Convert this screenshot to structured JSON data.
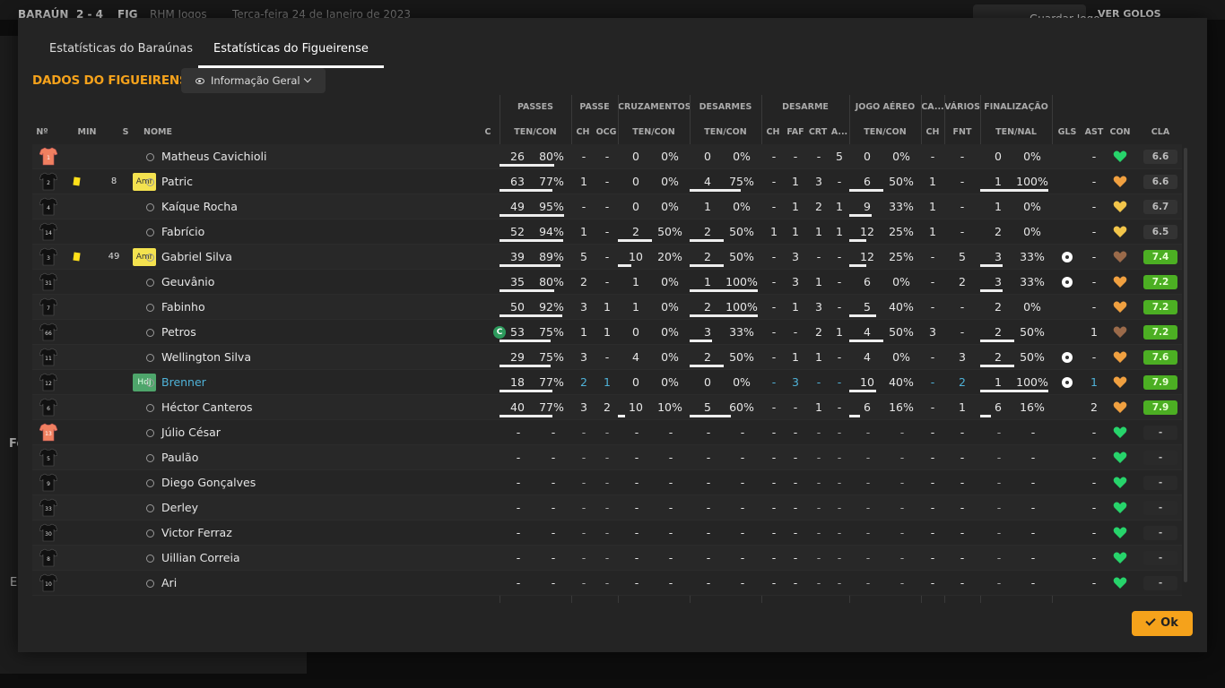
{
  "topbar": {
    "score_home": "BARAÚN",
    "score": "2 - 4",
    "score_away": "FIG",
    "venue": "RHM Jogos",
    "date": "Terça-feira 24 de Janeiro de 2023",
    "save_label": "Guardar Jogo",
    "ver_label": "VER GOLOS"
  },
  "background": {
    "text1": "Fo",
    "text2": "E"
  },
  "tabs": [
    {
      "label": "Estatísticas do Baraúnas",
      "active": false
    },
    {
      "label": "Estatísticas do Figueirense",
      "active": true
    }
  ],
  "section_title": "DADOS DO FIGUEIRENSE",
  "view_dropdown": {
    "selected": "Informação Geral"
  },
  "group_headers": [
    "PASSES",
    "PASSE",
    "CRUZAMENTOS",
    "DESARMES",
    "DESARME",
    "JOGO AÉREO",
    "CA...",
    "VÁRIOS",
    "FINALIZAÇÃO"
  ],
  "column_headers": {
    "num": "Nº",
    "min": "MIN",
    "s": "S",
    "name": "NOME",
    "c": "C",
    "passes": "TEN/CON",
    "passe_ch": "CH",
    "passe_ocg": "OCG",
    "cruz": "TEN/CON",
    "desarmes": "TEN/CON",
    "des_ch": "CH",
    "des_faf": "FAF",
    "des_crt": "CRT",
    "des_a": "A...",
    "aereo": "TEN/CON",
    "ca_ch": "CH",
    "var_fnt": "FNT",
    "final": "TEN/NAL",
    "gls": "GLS",
    "ast": "AST",
    "con": "CON",
    "cla": "CLA"
  },
  "players": [
    {
      "num": "1",
      "gk": true,
      "card": false,
      "min": "",
      "tag": "",
      "name": "Matheus Cavichioli",
      "c": false,
      "highlight": false,
      "p_ten": "26",
      "p_pct": "80%",
      "p_frac": 0.8,
      "p_ch": "-",
      "p_ocg": "-",
      "cr_ten": "0",
      "cr_pct": "0%",
      "cr_frac": 0,
      "de_ten": "0",
      "de_pct": "0%",
      "de_frac": 0,
      "d_ch": "-",
      "d_faf": "-",
      "d_crt": "-",
      "d_a": "5",
      "ae_ten": "0",
      "ae_pct": "0%",
      "ae_frac": 0,
      "ca_ch": "-",
      "fnt": "-",
      "f_ten": "0",
      "f_pct": "0%",
      "f_frac": 0,
      "gls": false,
      "ast": "-",
      "heart": "green",
      "cla": "6.6",
      "cla_color": "gray"
    },
    {
      "num": "2",
      "gk": false,
      "card": true,
      "min": "8",
      "tag": "Amr",
      "name": "Patric",
      "c": false,
      "highlight": false,
      "p_ten": "63",
      "p_pct": "77%",
      "p_frac": 0.77,
      "p_ch": "1",
      "p_ocg": "-",
      "cr_ten": "0",
      "cr_pct": "0%",
      "cr_frac": 0,
      "de_ten": "4",
      "de_pct": "75%",
      "de_frac": 0.75,
      "d_ch": "-",
      "d_faf": "1",
      "d_crt": "3",
      "d_a": "-",
      "ae_ten": "6",
      "ae_pct": "50%",
      "ae_frac": 0.5,
      "ca_ch": "1",
      "fnt": "-",
      "f_ten": "1",
      "f_pct": "100%",
      "f_frac": 1,
      "gls": false,
      "ast": "-",
      "heart": "orange",
      "cla": "6.6",
      "cla_color": "gray"
    },
    {
      "num": "4",
      "gk": false,
      "card": false,
      "min": "",
      "tag": "",
      "name": "Kaíque Rocha",
      "c": false,
      "highlight": false,
      "p_ten": "49",
      "p_pct": "95%",
      "p_frac": 0.95,
      "p_ch": "-",
      "p_ocg": "-",
      "cr_ten": "0",
      "cr_pct": "0%",
      "cr_frac": 0,
      "de_ten": "1",
      "de_pct": "0%",
      "de_frac": 0,
      "d_ch": "-",
      "d_faf": "1",
      "d_crt": "2",
      "d_a": "1",
      "ae_ten": "9",
      "ae_pct": "33%",
      "ae_frac": 0.33,
      "ca_ch": "1",
      "fnt": "-",
      "f_ten": "1",
      "f_pct": "0%",
      "f_frac": 0,
      "gls": false,
      "ast": "-",
      "heart": "yellow",
      "cla": "6.7",
      "cla_color": "gray"
    },
    {
      "num": "14",
      "gk": false,
      "card": false,
      "min": "",
      "tag": "",
      "name": "Fabrício",
      "c": false,
      "highlight": false,
      "p_ten": "52",
      "p_pct": "94%",
      "p_frac": 0.94,
      "p_ch": "1",
      "p_ocg": "-",
      "cr_ten": "2",
      "cr_pct": "50%",
      "cr_frac": 0.5,
      "de_ten": "2",
      "de_pct": "50%",
      "de_frac": 0.5,
      "d_ch": "1",
      "d_faf": "1",
      "d_crt": "1",
      "d_a": "1",
      "ae_ten": "12",
      "ae_pct": "25%",
      "ae_frac": 0.25,
      "ca_ch": "1",
      "fnt": "-",
      "f_ten": "2",
      "f_pct": "0%",
      "f_frac": 0,
      "gls": false,
      "ast": "-",
      "heart": "yellow",
      "cla": "6.5",
      "cla_color": "gray"
    },
    {
      "num": "3",
      "gk": false,
      "card": true,
      "min": "49",
      "tag": "Amr",
      "name": "Gabriel Silva",
      "c": false,
      "highlight": false,
      "p_ten": "39",
      "p_pct": "89%",
      "p_frac": 0.89,
      "p_ch": "5",
      "p_ocg": "-",
      "cr_ten": "10",
      "cr_pct": "20%",
      "cr_frac": 0.2,
      "de_ten": "2",
      "de_pct": "50%",
      "de_frac": 0.5,
      "d_ch": "-",
      "d_faf": "3",
      "d_crt": "-",
      "d_a": "-",
      "ae_ten": "12",
      "ae_pct": "25%",
      "ae_frac": 0.25,
      "ca_ch": "-",
      "fnt": "5",
      "f_ten": "3",
      "f_pct": "33%",
      "f_frac": 0.33,
      "gls": true,
      "ast": "-",
      "heart": "brown",
      "cla": "7.4",
      "cla_color": "green"
    },
    {
      "num": "31",
      "gk": false,
      "card": false,
      "min": "",
      "tag": "",
      "name": "Geuvânio",
      "c": false,
      "highlight": false,
      "p_ten": "35",
      "p_pct": "80%",
      "p_frac": 0.8,
      "p_ch": "2",
      "p_ocg": "-",
      "cr_ten": "1",
      "cr_pct": "0%",
      "cr_frac": 0,
      "de_ten": "1",
      "de_pct": "100%",
      "de_frac": 1,
      "d_ch": "-",
      "d_faf": "3",
      "d_crt": "1",
      "d_a": "-",
      "ae_ten": "6",
      "ae_pct": "0%",
      "ae_frac": 0,
      "ca_ch": "-",
      "fnt": "2",
      "f_ten": "3",
      "f_pct": "33%",
      "f_frac": 0.33,
      "gls": true,
      "ast": "-",
      "heart": "orange",
      "cla": "7.2",
      "cla_color": "green"
    },
    {
      "num": "7",
      "gk": false,
      "card": false,
      "min": "",
      "tag": "",
      "name": "Fabinho",
      "c": false,
      "highlight": false,
      "p_ten": "50",
      "p_pct": "92%",
      "p_frac": 0.92,
      "p_ch": "3",
      "p_ocg": "1",
      "cr_ten": "1",
      "cr_pct": "0%",
      "cr_frac": 0,
      "de_ten": "2",
      "de_pct": "100%",
      "de_frac": 1,
      "d_ch": "-",
      "d_faf": "1",
      "d_crt": "3",
      "d_a": "-",
      "ae_ten": "5",
      "ae_pct": "40%",
      "ae_frac": 0.4,
      "ca_ch": "-",
      "fnt": "-",
      "f_ten": "2",
      "f_pct": "0%",
      "f_frac": 0,
      "gls": false,
      "ast": "-",
      "heart": "orange",
      "cla": "7.2",
      "cla_color": "green"
    },
    {
      "num": "66",
      "gk": false,
      "card": false,
      "min": "",
      "tag": "",
      "name": "Petros",
      "c": true,
      "highlight": false,
      "p_ten": "53",
      "p_pct": "75%",
      "p_frac": 0.75,
      "p_ch": "1",
      "p_ocg": "1",
      "cr_ten": "0",
      "cr_pct": "0%",
      "cr_frac": 0,
      "de_ten": "3",
      "de_pct": "33%",
      "de_frac": 0.33,
      "d_ch": "-",
      "d_faf": "-",
      "d_crt": "2",
      "d_a": "1",
      "ae_ten": "4",
      "ae_pct": "50%",
      "ae_frac": 0.5,
      "ca_ch": "3",
      "fnt": "-",
      "f_ten": "2",
      "f_pct": "50%",
      "f_frac": 0.5,
      "gls": false,
      "ast": "1",
      "heart": "brown",
      "cla": "7.2",
      "cla_color": "green"
    },
    {
      "num": "11",
      "gk": false,
      "card": false,
      "min": "",
      "tag": "",
      "name": "Wellington Silva",
      "c": false,
      "highlight": false,
      "p_ten": "29",
      "p_pct": "75%",
      "p_frac": 0.75,
      "p_ch": "3",
      "p_ocg": "-",
      "cr_ten": "4",
      "cr_pct": "0%",
      "cr_frac": 0,
      "de_ten": "2",
      "de_pct": "50%",
      "de_frac": 0.5,
      "d_ch": "-",
      "d_faf": "1",
      "d_crt": "1",
      "d_a": "-",
      "ae_ten": "4",
      "ae_pct": "0%",
      "ae_frac": 0,
      "ca_ch": "-",
      "fnt": "3",
      "f_ten": "2",
      "f_pct": "50%",
      "f_frac": 0.5,
      "gls": true,
      "ast": "-",
      "heart": "orange",
      "cla": "7.6",
      "cla_color": "green"
    },
    {
      "num": "12",
      "gk": false,
      "card": false,
      "min": "",
      "tag": "HdJ",
      "name": "Brenner",
      "c": false,
      "highlight": true,
      "p_ten": "18",
      "p_pct": "77%",
      "p_frac": 0.77,
      "p_ch": "2",
      "p_ocg": "1",
      "cr_ten": "0",
      "cr_pct": "0%",
      "cr_frac": 0,
      "de_ten": "0",
      "de_pct": "0%",
      "de_frac": 0,
      "d_ch": "-",
      "d_faf": "3",
      "d_crt": "-",
      "d_a": "-",
      "ae_ten": "10",
      "ae_pct": "40%",
      "ae_frac": 0.4,
      "ca_ch": "-",
      "fnt": "2",
      "f_ten": "1",
      "f_pct": "100%",
      "f_frac": 1,
      "gls": true,
      "ast": "1",
      "heart": "orange",
      "cla": "7.9",
      "cla_color": "green"
    },
    {
      "num": "6",
      "gk": false,
      "card": false,
      "min": "",
      "tag": "",
      "name": "Héctor Canteros",
      "c": false,
      "highlight": false,
      "p_ten": "40",
      "p_pct": "77%",
      "p_frac": 0.77,
      "p_ch": "3",
      "p_ocg": "2",
      "cr_ten": "10",
      "cr_pct": "10%",
      "cr_frac": 0.1,
      "de_ten": "5",
      "de_pct": "60%",
      "de_frac": 0.6,
      "d_ch": "-",
      "d_faf": "-",
      "d_crt": "1",
      "d_a": "-",
      "ae_ten": "6",
      "ae_pct": "16%",
      "ae_frac": 0.16,
      "ca_ch": "-",
      "fnt": "1",
      "f_ten": "6",
      "f_pct": "16%",
      "f_frac": 0.16,
      "gls": false,
      "ast": "2",
      "heart": "orange",
      "cla": "7.9",
      "cla_color": "green"
    },
    {
      "num": "13",
      "gk": true,
      "sub": true,
      "name": "Júlio César",
      "heart": "green",
      "cla": "-"
    },
    {
      "num": "5",
      "gk": false,
      "sub": true,
      "name": "Paulão",
      "heart": "green",
      "cla": "-"
    },
    {
      "num": "9",
      "gk": false,
      "sub": true,
      "name": "Diego Gonçalves",
      "heart": "green",
      "cla": "-"
    },
    {
      "num": "33",
      "gk": false,
      "sub": true,
      "name": "Derley",
      "heart": "green",
      "cla": "-"
    },
    {
      "num": "30",
      "gk": false,
      "sub": true,
      "name": "Victor Ferraz",
      "heart": "green",
      "cla": "-"
    },
    {
      "num": "8",
      "gk": false,
      "sub": true,
      "name": "Uillian Correia",
      "heart": "green",
      "cla": "-"
    },
    {
      "num": "10",
      "gk": false,
      "sub": true,
      "name": "Ari",
      "heart": "green",
      "cla": "-"
    }
  ],
  "colors": {
    "accent": "#f5a21b",
    "highlight_blue": "#4fb2d8",
    "heart_green": "#27d46b",
    "heart_orange": "#f0a040",
    "heart_yellow": "#f2c54a",
    "heart_brown": "#9a6a4a",
    "rating_green": "#4caf23",
    "gk_shirt": "#f08060"
  },
  "ok_label": "Ok"
}
